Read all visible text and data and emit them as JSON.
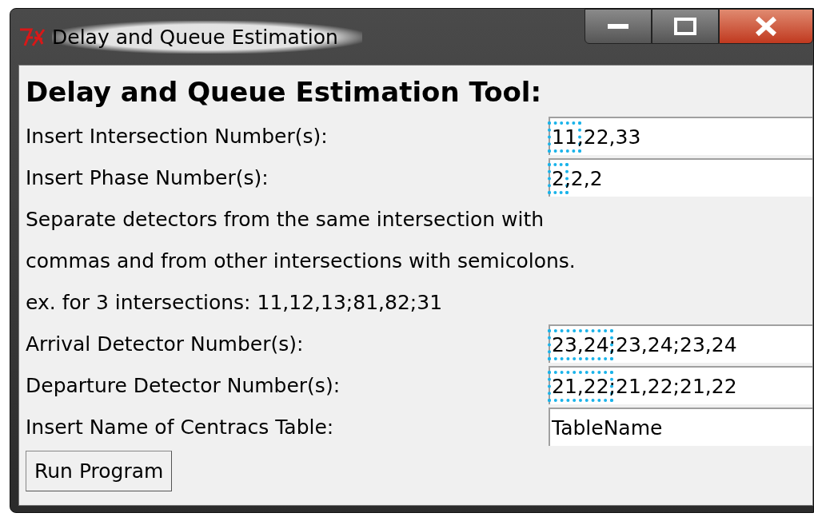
{
  "window": {
    "title": "Delay and Queue Estimation"
  },
  "heading": "Delay and Queue Estimation Tool:",
  "rows": [
    {
      "kind": "field",
      "label": "Insert Intersection Number(s):",
      "value_parts": [
        {
          "text": "11",
          "highlighted": true
        },
        {
          "text": ",22,33",
          "highlighted": false
        }
      ]
    },
    {
      "kind": "field",
      "label": "Insert Phase Number(s):",
      "value_parts": [
        {
          "text": "2",
          "highlighted": true
        },
        {
          "text": ",2,2",
          "highlighted": false
        }
      ]
    },
    {
      "kind": "note",
      "label": "Separate detectors from the same intersection with"
    },
    {
      "kind": "note",
      "label": "commas and from other intersections with semicolons."
    },
    {
      "kind": "note",
      "label": "ex. for 3 intersections: 11,12,13;81,82;31"
    },
    {
      "kind": "field",
      "label": "Arrival Detector Number(s):",
      "value_parts": [
        {
          "text": "23,24",
          "highlighted": true
        },
        {
          "text": ";23,24;23,24",
          "highlighted": false
        }
      ]
    },
    {
      "kind": "field",
      "label": "Departure Detector Number(s):",
      "value_parts": [
        {
          "text": "21,22",
          "highlighted": true
        },
        {
          "text": ";21,22;21,22",
          "highlighted": false
        }
      ]
    },
    {
      "kind": "field",
      "label": "Insert Name of Centracs Table:",
      "value": "TableName"
    }
  ],
  "button": "Run Program"
}
